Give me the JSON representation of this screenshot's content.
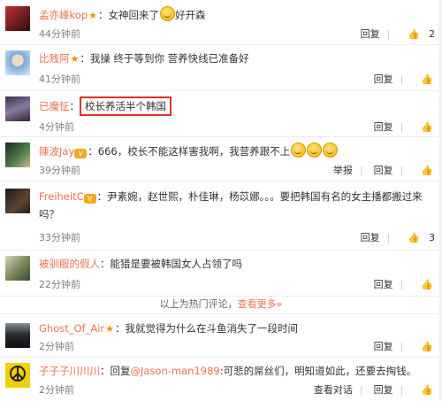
{
  "comments": [
    {
      "user": "孟亦峰kop",
      "star": true,
      "vip": false,
      "sep": "：",
      "text": "女神回来了",
      "emoji_after": 1,
      "emoji_tail": "好开森",
      "time": "44分钟前",
      "reply": "回复",
      "likes": "2",
      "avatar_color": "#8a2a2a"
    },
    {
      "user": "比贱阿",
      "star": true,
      "vip": false,
      "sep": "：",
      "text": "我操 终于等到你 营养快线已准备好",
      "time": "41分钟前",
      "reply": "回复",
      "likes": "",
      "avatar_color": "#5c8cc0"
    },
    {
      "user": "已魔怔",
      "star": false,
      "vip": false,
      "sep": "：",
      "highlight": "校长养活半个韩国",
      "time": "4分钟前",
      "reply": "回复",
      "likes": "",
      "avatar_color": "#4a3f5c"
    },
    {
      "user": "陳波Jay",
      "star": false,
      "vip": true,
      "vip_text": "V",
      "sep": "：",
      "text": "666，校长不能这样害我啊，我营养跟不上",
      "time": "39分钟前",
      "report": "举报",
      "reply": "回复",
      "likes": "",
      "avatar_color": "#2e4a3a"
    },
    {
      "user": "FreiheitC",
      "star": false,
      "vip": true,
      "vip_text": "V",
      "sep": "：",
      "text": "尹素婉，赵世熙，朴佳琳，杨苡娜。。。要把韩国有名的女主播都搬过来吗？",
      "time": "33分钟前",
      "reply": "回复",
      "likes": "3",
      "avatar_color": "#3a2a20"
    },
    {
      "user": "被驯服的假人",
      "star": false,
      "vip": false,
      "sep": "：",
      "text": "能猎是要被韩国女人占领了吗",
      "time": "22分钟前",
      "reply": "回复",
      "likes": "",
      "avatar_color": "#6a7a4a"
    },
    {
      "user": "Ghost_Of_Air",
      "star": true,
      "vip": false,
      "sep": "：",
      "text": "我就觉得为什么在斗鱼消失了一段时间",
      "time": "2分钟前",
      "reply": "回复",
      "likes": "",
      "avatar_color": "#20242a"
    },
    {
      "user": "子子子川川川",
      "star": false,
      "vip": false,
      "sep": "：",
      "text_prefix": "回复",
      "mention": "@Jason-man1989",
      "text": ":可悲的屌丝们，明知道如此，还要去掏钱。",
      "time": "2分钟前",
      "view_convo": "查看对话",
      "reply": "回复",
      "likes": "",
      "avatar_color": "#f2d200"
    }
  ],
  "section": {
    "text": "以上为热门评论，",
    "more": "查看更多»"
  },
  "icons": {
    "like": "thumbs-up-icon",
    "star": "star-icon",
    "vip": "vip-badge-icon",
    "emoji": "laughing-emoji-icon"
  }
}
